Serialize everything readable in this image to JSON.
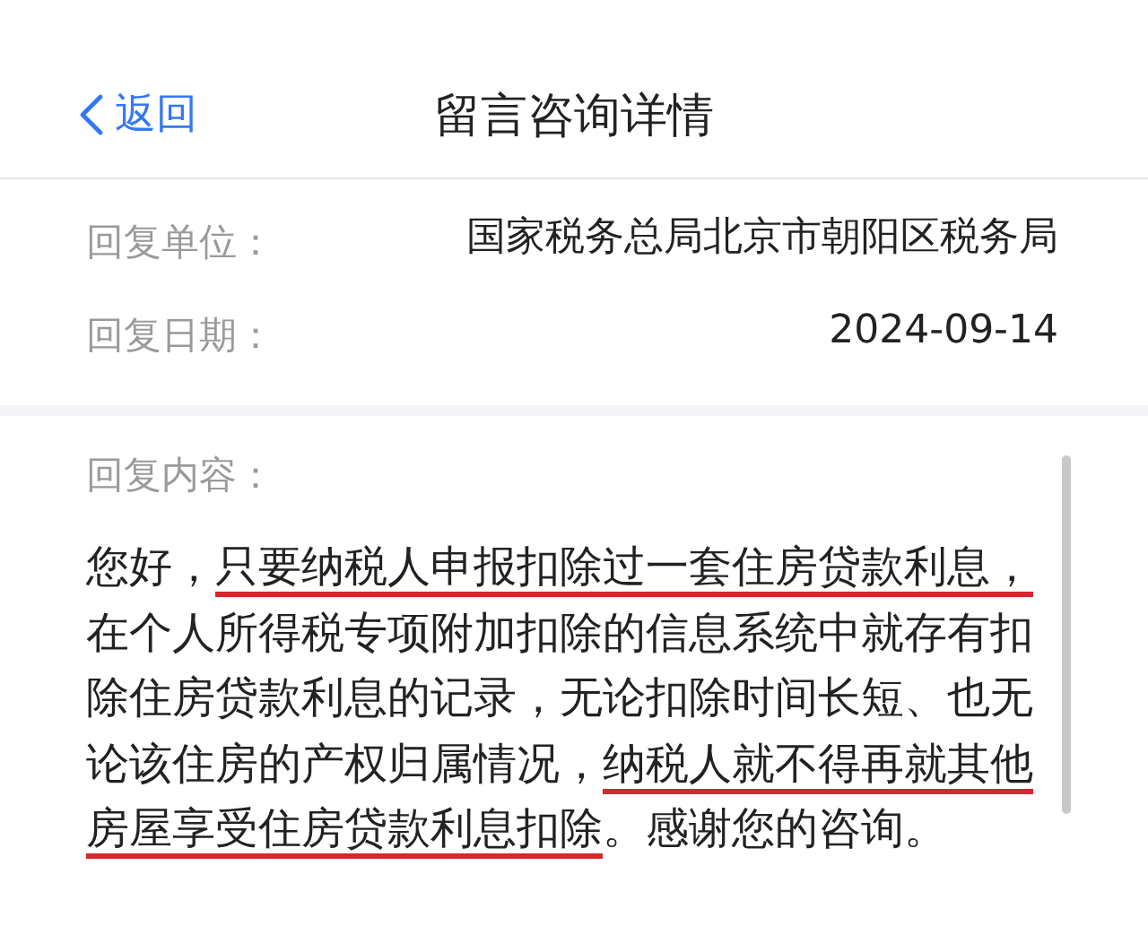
{
  "header": {
    "back": "返回",
    "title": "留言咨询详情"
  },
  "fields": [
    {
      "label": "回复单位：",
      "value": "国家税务总局北京市朝阳区税务局"
    },
    {
      "label": "回复日期：",
      "value": "2024-09-14"
    }
  ],
  "reply": {
    "label": "回复内容：",
    "segments": [
      {
        "text": "您好，",
        "underlined": false
      },
      {
        "text": "只要纳税人申报扣除过一套住房贷款利息，",
        "underlined": true
      },
      {
        "text": "在个人所得税专项附加扣除的信息系统中就存有扣除住房贷款利息的记录，无论扣除时间长短、也无论该住房的产权归属情况，",
        "underlined": false
      },
      {
        "text": "纳税人就不得再就其他房屋享受住房贷款利息扣除",
        "underlined": true
      },
      {
        "text": "。感谢您的咨询。",
        "underlined": false
      }
    ]
  }
}
